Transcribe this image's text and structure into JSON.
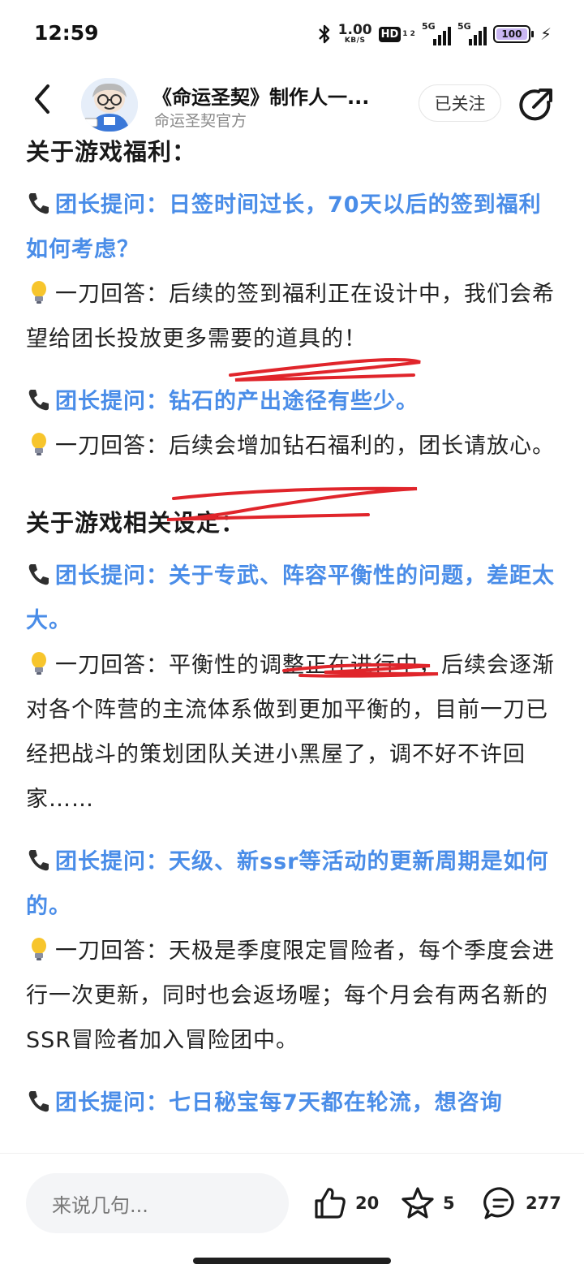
{
  "status_bar": {
    "time": "12:59",
    "net_speed_value": "1.00",
    "net_speed_unit": "KB/S",
    "hd_label": "HD",
    "hd_sub": "1 2",
    "signal_1": "5G",
    "signal_2": "5G",
    "battery": "100"
  },
  "header": {
    "title": "《命运圣契》制作人一...",
    "subtitle": "命运圣契官方",
    "follow_label": "已关注"
  },
  "article": {
    "heading_welfare": "关于游戏福利：",
    "q1": "团长提问：日签时间过长，70天以后的签到福利如何考虑？",
    "a1": "一刀回答：后续的签到福利正在设计中，我们会希望给团长投放更多需要的道具的！",
    "q2": "团长提问：钻石的产出途径有些少。",
    "a2": "一刀回答：后续会增加钻石福利的，团长请放心。",
    "heading_settings": "关于游戏相关设定：",
    "q3": "团长提问：关于专武、阵容平衡性的问题，差距太大。",
    "a3": "一刀回答：平衡性的调整正在进行中，后续会逐渐对各个阵营的主流体系做到更加平衡的，目前一刀已经把战斗的策划团队关进小黑屋了，调不好不许回家……",
    "q4": "团长提问：天级、新ssr等活动的更新周期是如何的。",
    "a4": "一刀回答：天极是季度限定冒险者，每个季度会进行一次更新，同时也会返场喔；每个月会有两名新的SSR冒险者加入冒险团中。",
    "q5_partial": "团长提问：七日秘宝每7天都在轮流，想咨询"
  },
  "bottom_bar": {
    "comment_placeholder": "来说几句...",
    "likes": "20",
    "favorites": "5",
    "comments": "277"
  },
  "colors": {
    "question_blue": "#4a8de8",
    "scribble_red": "#e0252b"
  },
  "icons": [
    "back-icon",
    "avatar",
    "share-icon",
    "phone-icon",
    "bulb-icon",
    "like-icon",
    "star-icon",
    "comment-icon"
  ]
}
